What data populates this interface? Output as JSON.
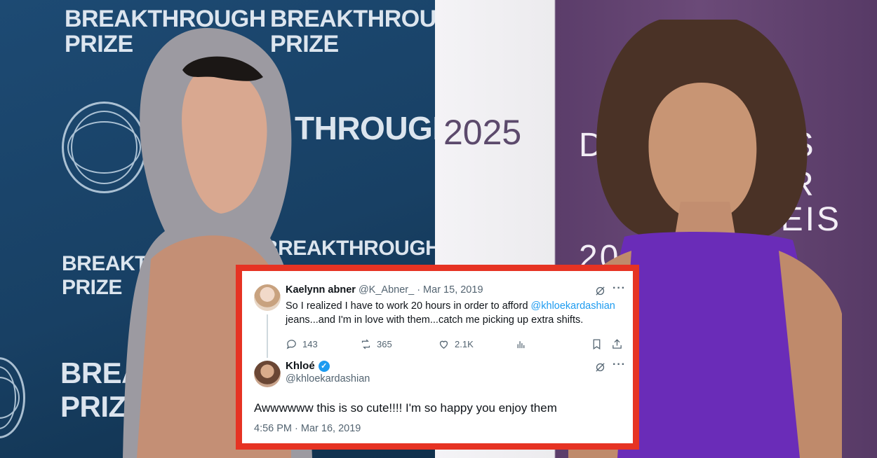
{
  "backdrop_left": {
    "words": [
      "BREAKTHROUGH",
      "PRIZE",
      "BREAKTHROUGH",
      "PRIZE",
      "THROUGH",
      "BREAKTHROUGH",
      "BREAKT",
      "PRIZE",
      "BREA",
      "PRIZE"
    ]
  },
  "backdrop_right": {
    "year": "2025",
    "letters": [
      "D",
      "RS",
      "ER",
      "REIS",
      "202"
    ]
  },
  "tweet": {
    "author_name": "Kaelynn abner",
    "author_handle": "@K_Abner_",
    "date": "· Mar 15, 2019",
    "text_before_mention": "So I realized I have to work 20 hours in order to afford ",
    "mention": "@khloekardashian",
    "text_after_mention": "jeans...and I'm in love with them...catch me picking up extra shifts.",
    "replies": "143",
    "retweets": "365",
    "likes": "2.1K"
  },
  "reply": {
    "author_name": "Khloé",
    "verified_icon": "✓",
    "author_handle": "@khloekardashian",
    "text": "Awwwwww this is so cute!!!! I'm so happy you enjoy them",
    "timestamp": "4:56 PM · Mar 16, 2019"
  },
  "colors": {
    "frame": "#e63323",
    "link": "#1d9bf0",
    "muted": "#536471"
  }
}
